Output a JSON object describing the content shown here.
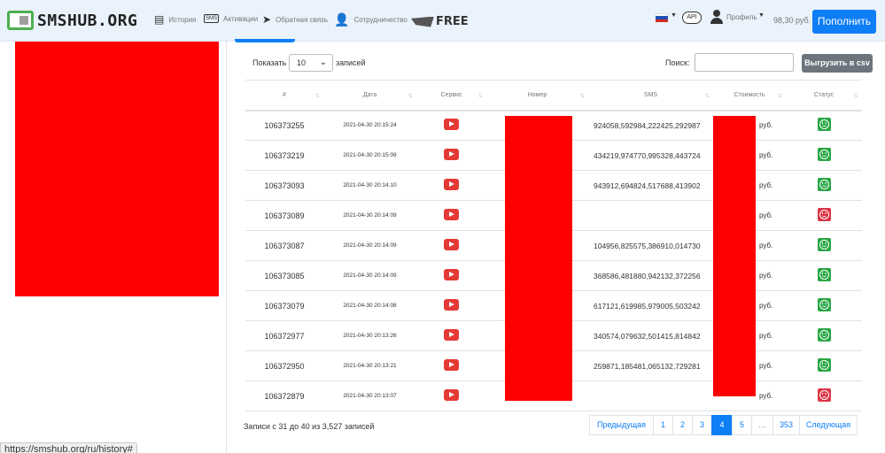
{
  "brand": {
    "logo_text": "SMSHUB.ORG",
    "hubfree_text": "FREE"
  },
  "nav": {
    "items": [
      {
        "label": "История",
        "icon": "document-icon"
      },
      {
        "label": "Активации",
        "icon": "sms-icon"
      },
      {
        "label": "Обратная связь",
        "icon": "paper-plane-icon"
      },
      {
        "label": "Сотрудничество",
        "icon": "user-plus-icon"
      }
    ],
    "api_label": "API",
    "profile_label": "Профиль",
    "balance": "98,30 руб.",
    "topup_label": "Пополнить"
  },
  "controls": {
    "show_label": "Показать",
    "page_length": "10",
    "records_label": "записей",
    "search_label": "Поиск:",
    "search_value": "",
    "csv_label": "Выгрузить в csv"
  },
  "table": {
    "columns": [
      "#",
      "Дата",
      "Сервис",
      "Номер",
      "SMS",
      "Стоимость",
      "Статус"
    ],
    "rows": [
      {
        "id": "106373255",
        "date": "2021-04-30 20:15:24",
        "sms": "924058,592984,222425,292987",
        "cost": "руб.",
        "status": "ok"
      },
      {
        "id": "106373219",
        "date": "2021-04-30 20:15:09",
        "sms": "434219,974770,995328,443724",
        "cost": "руб.",
        "status": "ok"
      },
      {
        "id": "106373093",
        "date": "2021-04-30 20:14:10",
        "sms": "943912,694824,517688,413902",
        "cost": "руб.",
        "status": "ok"
      },
      {
        "id": "106373089",
        "date": "2021-04-30 20:14:09",
        "sms": "",
        "cost": "руб.",
        "status": "bad"
      },
      {
        "id": "106373087",
        "date": "2021-04-30 20:14:09",
        "sms": "104956,825575,386910,014730",
        "cost": "руб.",
        "status": "ok"
      },
      {
        "id": "106373085",
        "date": "2021-04-30 20:14:09",
        "sms": "368586,481880,942132,372256",
        "cost": "руб.",
        "status": "ok"
      },
      {
        "id": "106373079",
        "date": "2021-04-30 20:14:08",
        "sms": "617121,619985,979005,503242",
        "cost": "руб.",
        "status": "ok"
      },
      {
        "id": "106372977",
        "date": "2021-04-30 20:13:26",
        "sms": "340574,079632,501415,814842",
        "cost": "руб.",
        "status": "ok"
      },
      {
        "id": "106372950",
        "date": "2021-04-30 20:13:21",
        "sms": "259871,185481,065132,729281",
        "cost": "руб.",
        "status": "ok"
      },
      {
        "id": "106372879",
        "date": "2021-04-30 20:13:07",
        "sms": "",
        "cost": "руб.",
        "status": "bad"
      }
    ]
  },
  "footer": {
    "info": "Записи с 31 до 40 из 3,527 записей",
    "pagination": [
      "Предыдущая",
      "1",
      "2",
      "3",
      "4",
      "5",
      "…",
      "353",
      "Следующая"
    ],
    "active_page": "4"
  },
  "status_bar_url": "https://smshub.org/ru/history#",
  "colors": {
    "primary": "#0d7ef5",
    "success": "#28a745",
    "danger": "#dc3545",
    "redaction": "#ff0000",
    "navbar": "#eaf2fb"
  }
}
